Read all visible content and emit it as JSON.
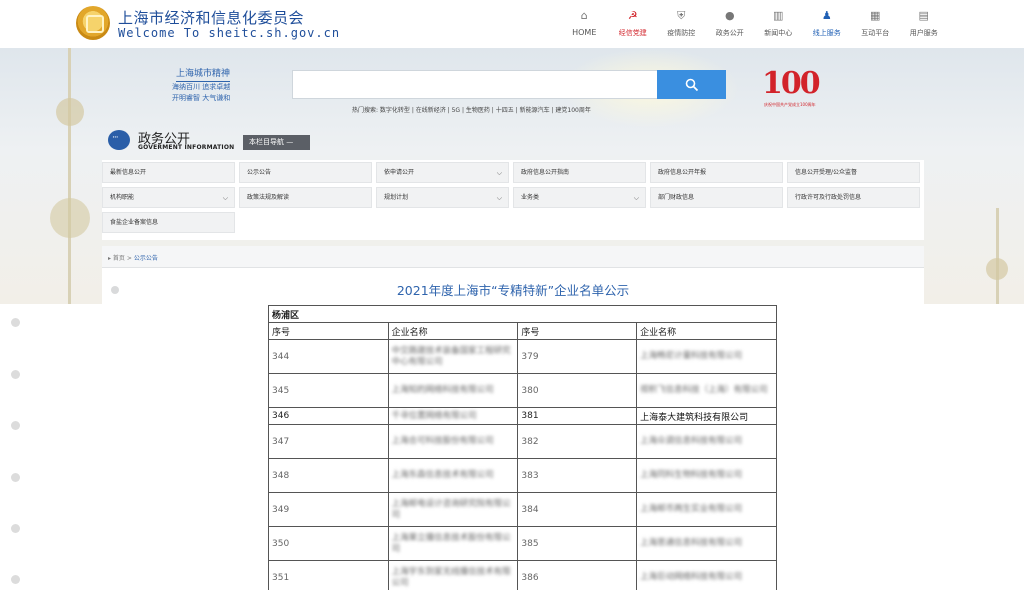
{
  "header": {
    "title": "上海市经济和信息化委员会",
    "subtitle": "Welcome To sheitc.sh.gov.cn",
    "nav": [
      {
        "label": "HOME",
        "icon": "home-icon",
        "state": "normal"
      },
      {
        "label": "经信党建",
        "icon": "party-emblem-icon",
        "state": "red"
      },
      {
        "label": "疫情防控",
        "icon": "shield-icon",
        "state": "normal"
      },
      {
        "label": "政务公开",
        "icon": "chat-icon",
        "state": "normal"
      },
      {
        "label": "新闻中心",
        "icon": "book-icon",
        "state": "normal"
      },
      {
        "label": "线上服务",
        "icon": "users-icon",
        "state": "active"
      },
      {
        "label": "互动平台",
        "icon": "grid-icon",
        "state": "normal"
      },
      {
        "label": "用户服务",
        "icon": "user-card-icon",
        "state": "normal"
      }
    ]
  },
  "hero": {
    "motto_title": "上海城市精神",
    "motto_line1": "海纳百川 追求卓越",
    "motto_line2": "开明睿智 大气谦和",
    "hot_search": "热门搜索: 数字化转型 | 在线新经济 | 5G | 生物医药 | 十四五 | 新能源汽车 | 建党100周年",
    "badge_number": "100",
    "badge_caption": "庆祝中国共产党成立100周年"
  },
  "section": {
    "title": "政务公开",
    "subtitle": "GOVERMENT INFORMATION",
    "nav_guide": "本栏目导航 —"
  },
  "menu": [
    {
      "label": "最新信息公开",
      "chevron": false
    },
    {
      "label": "公示公告",
      "chevron": false
    },
    {
      "label": "依申请公开",
      "chevron": true
    },
    {
      "label": "政府信息公开指南",
      "chevron": false
    },
    {
      "label": "政府信息公开年报",
      "chevron": false
    },
    {
      "label": "信息公开受理/公众监督",
      "chevron": false
    },
    {
      "label": "机构职能",
      "chevron": true
    },
    {
      "label": "政策法规及解读",
      "chevron": false
    },
    {
      "label": "规划计划",
      "chevron": true
    },
    {
      "label": "业务类",
      "chevron": true
    },
    {
      "label": "部门财政信息",
      "chevron": false
    },
    {
      "label": "行政许可及行政处罚信息",
      "chevron": false
    },
    {
      "label": "食盐企业备案信息",
      "chevron": false
    }
  ],
  "breadcrumb": {
    "home": "首页",
    "separator": ">",
    "current": "公示公告"
  },
  "document": {
    "title": "2021年度上海市“专精特新”企业名单公示",
    "district": "杨浦区",
    "col_no": "序号",
    "col_name": "企业名称",
    "rows": [
      {
        "no_a": "344",
        "name_a": "中交路建技术装备国家工程研究中心有限公司",
        "no_b": "379",
        "name_b": "上海畅尼计量科技有限公司",
        "size": "tall",
        "clear_b": false
      },
      {
        "no_a": "345",
        "name_a": "上海知的网络科技有限公司",
        "no_b": "380",
        "name_b": "视积飞信息科技（上海）有限公司",
        "size": "tall",
        "clear_b": false
      },
      {
        "no_a": "346",
        "name_a": "千寻位置网络有限公司",
        "no_b": "381",
        "name_b": "上海泰大建筑科技有限公司",
        "size": "mid",
        "clear_b": true
      },
      {
        "no_a": "347",
        "name_a": "上海合可科技股份有限公司",
        "no_b": "382",
        "name_b": "上海众调信息科技有限公司",
        "size": "tall",
        "clear_b": false
      },
      {
        "no_a": "348",
        "name_a": "上海东森信息技术有限公司",
        "no_b": "383",
        "name_b": "上海同科生物科技有限公司",
        "size": "tall",
        "clear_b": false
      },
      {
        "no_a": "349",
        "name_a": "上海邮电设计咨询研究院有限公司",
        "no_b": "384",
        "name_b": "上海邮币两生实业有限公司",
        "size": "tall",
        "clear_b": false
      },
      {
        "no_a": "350",
        "name_a": "上海果立播信息技术股份有限公司",
        "no_b": "385",
        "name_b": "上海思通信息科技有限公司",
        "size": "tall",
        "clear_b": false
      },
      {
        "no_a": "351",
        "name_a": "上海宇东到家无线播信技术有限公司",
        "no_b": "386",
        "name_b": "上海巨动网络科技有限公司",
        "size": "tall",
        "clear_b": false
      }
    ]
  },
  "colors": {
    "brand_blue": "#1f4e9a",
    "accent_red": "#d2232a",
    "search_blue": "#3a8fe0"
  }
}
